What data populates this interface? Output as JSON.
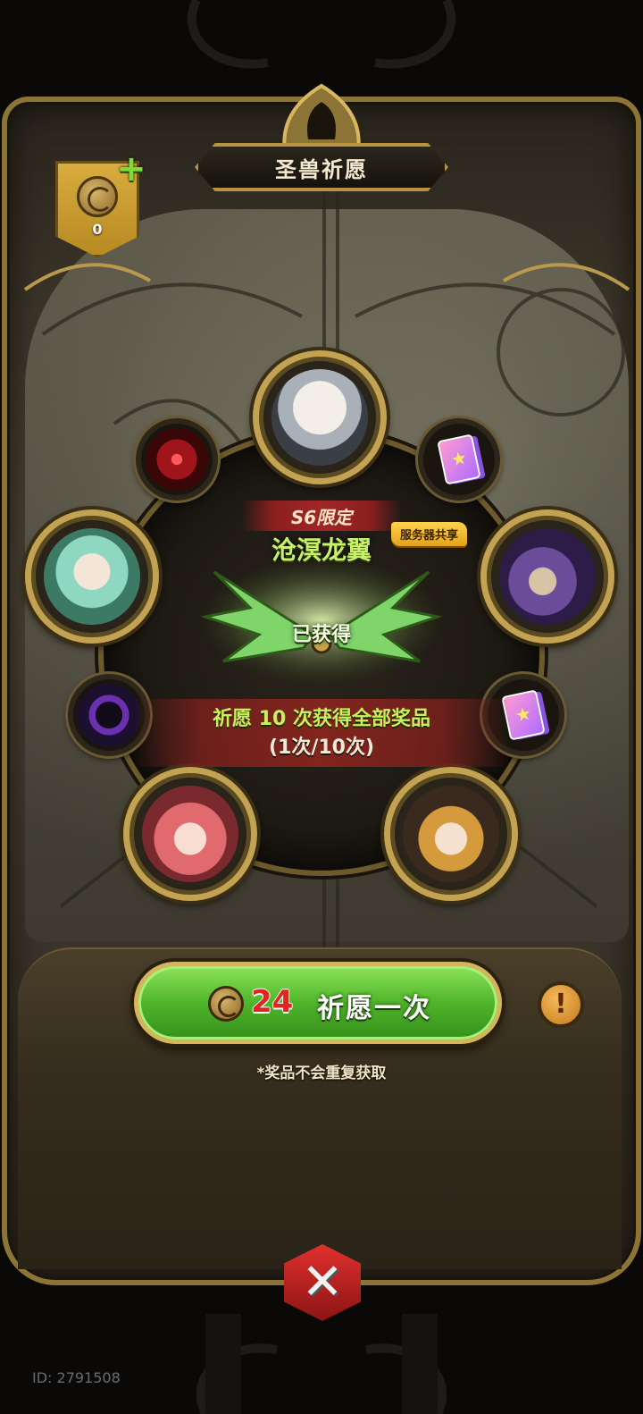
{
  "header": {
    "title": "圣兽祈愿"
  },
  "currency": {
    "amount": "0",
    "icon": "wish-coin-icon",
    "add_icon": "plus-icon"
  },
  "wheel": {
    "slots": [
      {
        "name": "top",
        "kind": "character",
        "icon": "white-hair-character-portrait"
      },
      {
        "name": "top-right",
        "kind": "item",
        "icon": "card-pack-icon"
      },
      {
        "name": "right",
        "kind": "character",
        "icon": "purple-armor-character-portrait"
      },
      {
        "name": "bottom-right-small",
        "kind": "item",
        "icon": "card-pack-icon"
      },
      {
        "name": "bottom-right",
        "kind": "character",
        "icon": "golden-crown-character-portrait"
      },
      {
        "name": "bottom-left",
        "kind": "character",
        "icon": "red-hair-character-portrait"
      },
      {
        "name": "left-small",
        "kind": "item",
        "icon": "purple-ring-frame-icon"
      },
      {
        "name": "left",
        "kind": "character",
        "icon": "green-dragon-character-portrait"
      },
      {
        "name": "top-left",
        "kind": "item",
        "icon": "red-demon-avatar-icon"
      }
    ]
  },
  "reward": {
    "limited_label": "S6限定",
    "name": "沧溟龙翼",
    "tag": "服务器共享",
    "status": "已获得",
    "icon": "dragon-wings-icon"
  },
  "progress": {
    "line1": "祈愿 10 次获得全部奖品",
    "line2": "(1次/10次)",
    "current": 1,
    "total": 10
  },
  "wish_button": {
    "cost": "24",
    "label": "祈愿一次"
  },
  "info_button": {
    "label": "!"
  },
  "note": "*奖品不会重复获取",
  "close_icon": "✕",
  "user_id": "ID: 2791508",
  "colors": {
    "accent_gold": "#c3a251",
    "button_green": "#4fb52a",
    "cost_red": "#e0261e",
    "reward_green": "#c8f06c"
  }
}
